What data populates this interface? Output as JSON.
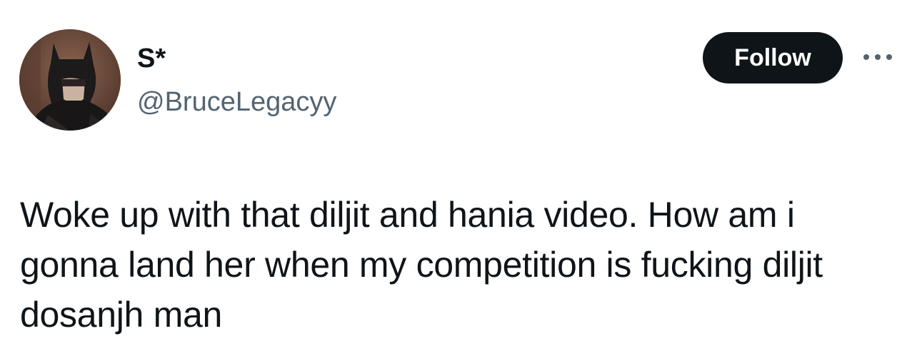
{
  "author": {
    "display_name": "S*",
    "handle": "@BruceLegacyy",
    "avatar_icon": "batman-avatar"
  },
  "actions": {
    "follow_label": "Follow",
    "more_icon": "more-horizontal-icon"
  },
  "tweet": {
    "text": "Woke up with that diljit and hania video. How am i gonna land her when my competition is fucking diljit dosanjh man"
  },
  "colors": {
    "text_primary": "#0f1419",
    "text_secondary": "#536471",
    "follow_bg": "#0f1419",
    "follow_text": "#ffffff"
  }
}
